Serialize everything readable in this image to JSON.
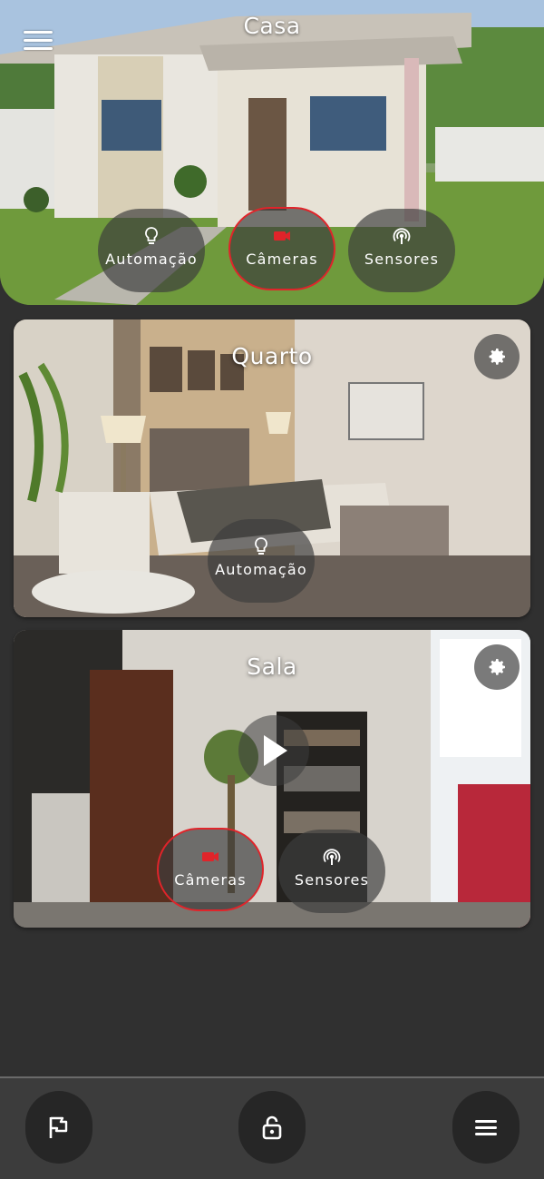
{
  "header": {
    "title": "Casa",
    "menu_icon": "hamburger-menu-icon",
    "actions": [
      {
        "label": "Automação",
        "icon": "lightbulb-icon",
        "active": false
      },
      {
        "label": "Câmeras",
        "icon": "video-camera-icon",
        "active": true
      },
      {
        "label": "Sensores",
        "icon": "sensor-signal-icon",
        "active": false
      }
    ]
  },
  "rooms": [
    {
      "title": "Quarto",
      "settings_icon": "gear-icon",
      "actions": [
        {
          "label": "Automação",
          "icon": "lightbulb-icon",
          "active": false
        }
      ]
    },
    {
      "title": "Sala",
      "settings_icon": "gear-icon",
      "play_icon": "play-icon",
      "actions": [
        {
          "label": "Câmeras",
          "icon": "video-camera-icon",
          "active": true
        },
        {
          "label": "Sensores",
          "icon": "sensor-signal-icon",
          "active": false
        }
      ]
    }
  ],
  "bottom_nav": [
    {
      "icon": "flag-icon"
    },
    {
      "icon": "unlock-icon"
    },
    {
      "icon": "menu-icon"
    }
  ],
  "colors": {
    "background": "#303030",
    "active_outline": "#e0242a",
    "camera_icon": "#e0242a",
    "bottom_bar": "#3c3c3c"
  }
}
